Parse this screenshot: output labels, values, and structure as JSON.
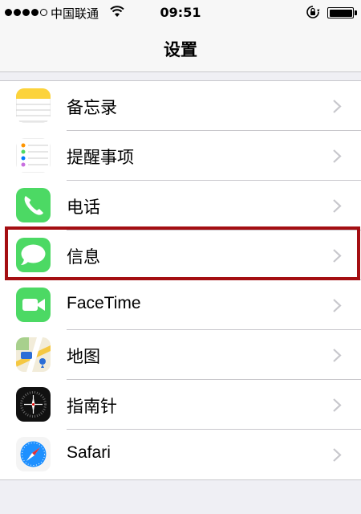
{
  "status_bar": {
    "carrier": "中国联通",
    "time": "09:51",
    "signal_bars_filled": 4,
    "signal_bars_total": 5,
    "battery_level": 1.0
  },
  "nav": {
    "title": "设置"
  },
  "settings_items": [
    {
      "label": "备忘录",
      "icon": "notes-icon"
    },
    {
      "label": "提醒事项",
      "icon": "reminders-icon"
    },
    {
      "label": "电话",
      "icon": "phone-icon"
    },
    {
      "label": "信息",
      "icon": "messages-icon",
      "highlighted": true
    },
    {
      "label": "FaceTime",
      "icon": "facetime-icon"
    },
    {
      "label": "地图",
      "icon": "maps-icon"
    },
    {
      "label": "指南针",
      "icon": "compass-icon"
    },
    {
      "label": "Safari",
      "icon": "safari-icon"
    }
  ],
  "colors": {
    "highlight_border": "#a40e12",
    "green": "#4cd964",
    "background": "#efeff4"
  }
}
